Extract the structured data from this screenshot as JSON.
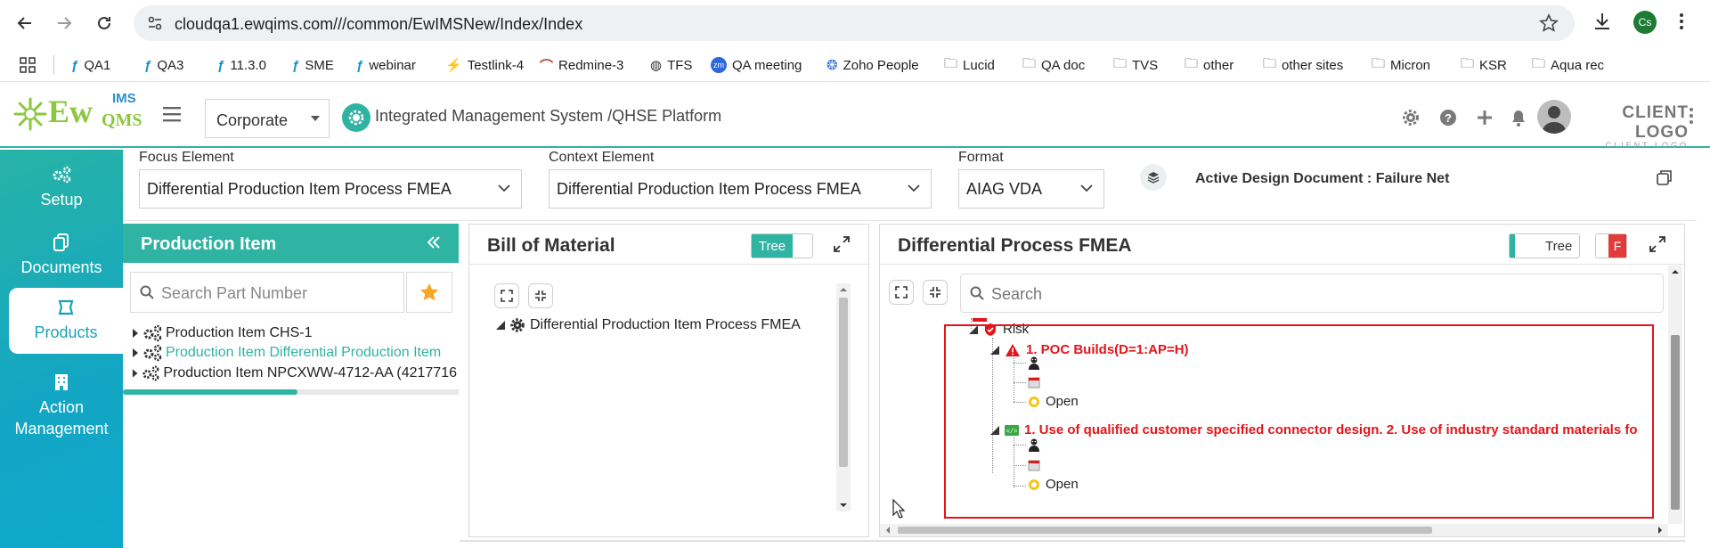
{
  "browser": {
    "url": "cloudqa1.ewqims.com///common/EwIMSNew/Index/Index",
    "profile_initials": "Cs",
    "bookmarks": [
      "QA1",
      "QA3",
      "11.3.0",
      "SME",
      "webinar",
      "Testlink-4",
      "Redmine-3",
      "TFS",
      "QA meeting",
      "Zoho People",
      "Lucid",
      "QA doc",
      "TVS",
      "other",
      "other sites",
      "Micron",
      "KSR",
      "Aqua rec"
    ]
  },
  "header": {
    "logo_text": "Ew",
    "logo_superscript": "IMS",
    "logo_subscript": "QMS",
    "org_select": "Corporate",
    "platform_title": "Integrated Management System /QHSE Platform",
    "client_logo": "CLIENT LOGO",
    "client_logo_sub": "CLIENT LOGO"
  },
  "sidebar": {
    "items": [
      {
        "label": "Setup",
        "icon": "gears-icon"
      },
      {
        "label": "Documents",
        "icon": "documents-icon"
      },
      {
        "label": "Products",
        "icon": "products-icon"
      },
      {
        "label": "Action Management",
        "icon": "building-icon"
      }
    ]
  },
  "filters": {
    "focus_label": "Focus Element",
    "focus_value": "Differential Production Item Process FMEA",
    "context_label": "Context Element",
    "context_value": "Differential Production Item Process FMEA",
    "format_label": "Format",
    "format_value": "AIAG VDA",
    "active_doc": "Active Design Document : Failure Net"
  },
  "production_panel": {
    "title": "Production Item",
    "search_placeholder": "Search Part Number",
    "items": [
      "Production Item CHS-1",
      "Production Item Differential Production Item",
      "Production Item NPCXWW-4712-AA (4217716"
    ],
    "scroll_progress": 0.52
  },
  "bom_panel": {
    "title": "Bill of Material",
    "toggle_label": "Tree",
    "node": "Differential Production Item Process FMEA"
  },
  "fmea_panel": {
    "title": "Differential Process FMEA",
    "toggle_label": "Tree",
    "toggle_f": "F",
    "search_placeholder": "Search",
    "risk_label": "Risk",
    "failure_mode": "1. POC Builds(D=1:AP=H)",
    "status_1": "Open",
    "control": "1. Use of qualified customer specified connector design. 2. Use of industry standard materials fo",
    "status_2": "Open"
  }
}
